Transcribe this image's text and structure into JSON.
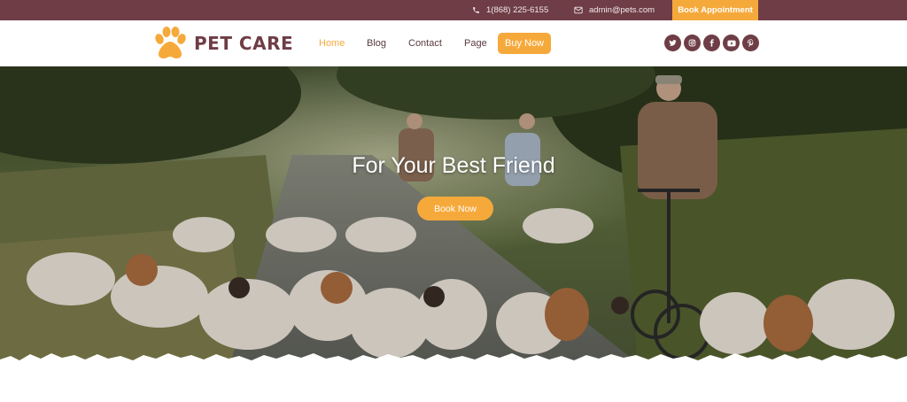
{
  "topbar": {
    "phone": "1(868) 225-6155",
    "email": "admin@pets.com",
    "book_appointment": "Book Appointment"
  },
  "header": {
    "logo_text": "PET CARE",
    "nav": {
      "home": "Home",
      "blog": "Blog",
      "contact": "Contact",
      "page": "Page",
      "buy_now": "Buy Now"
    },
    "socials": [
      "twitter-icon",
      "instagram-icon",
      "facebook-icon",
      "youtube-icon",
      "pinterest-icon"
    ]
  },
  "hero": {
    "title": "For Your Best Friend",
    "button": "Book Now"
  },
  "colors": {
    "brand": "#6e3d46",
    "accent": "#f6a93b"
  }
}
